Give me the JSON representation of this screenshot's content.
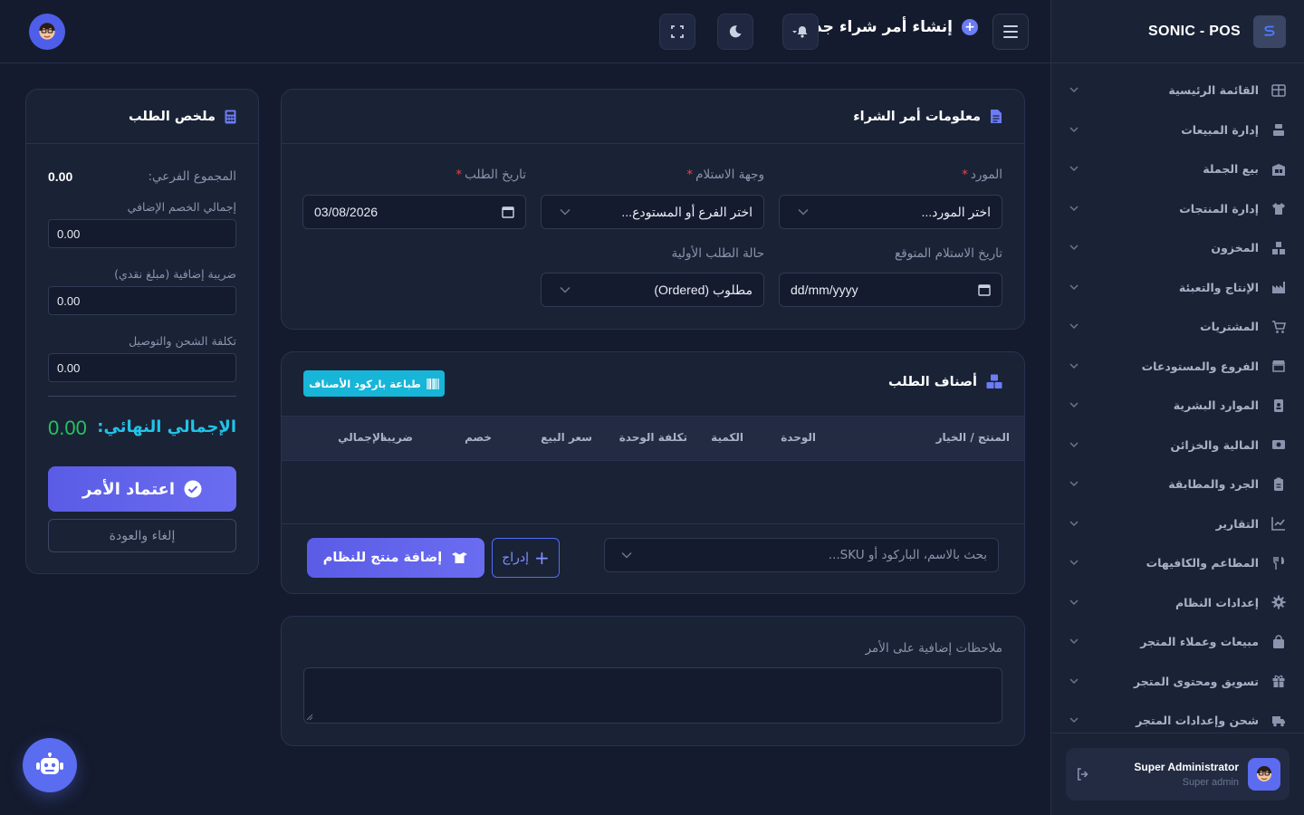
{
  "brand": {
    "name": "SONIC - POS"
  },
  "sidebar": {
    "items": [
      {
        "label": "القائمة الرئيسية",
        "icon": "table-icon"
      },
      {
        "label": "إدارة المبيعات",
        "icon": "register-icon"
      },
      {
        "label": "بيع الجملة",
        "icon": "warehouse-boxes-icon"
      },
      {
        "label": "إدارة المنتجات",
        "icon": "shirt-icon"
      },
      {
        "label": "المخزون",
        "icon": "boxes-icon"
      },
      {
        "label": "الإنتاج والتعبئة",
        "icon": "industry-icon"
      },
      {
        "label": "المشتريات",
        "icon": "cart-icon"
      },
      {
        "label": "الفروع والمستودعات",
        "icon": "store-icon"
      },
      {
        "label": "الموارد البشرية",
        "icon": "id-badge-icon"
      },
      {
        "label": "المالية والخزائن",
        "icon": "money-icon"
      },
      {
        "label": "الجرد والمطابقة",
        "icon": "clipboard-icon"
      },
      {
        "label": "التقارير",
        "icon": "chart-line-icon"
      },
      {
        "label": "المطاعم والكافيهات",
        "icon": "utensils-icon"
      },
      {
        "label": "إعدادات النظام",
        "icon": "gear-icon"
      },
      {
        "label": "مبيعات وعملاء المتجر",
        "icon": "bag-icon"
      },
      {
        "label": "تسويق ومحتوى المتجر",
        "icon": "gift-icon"
      },
      {
        "label": "شحن وإعدادات المتجر",
        "icon": "truck-icon"
      }
    ],
    "user": {
      "name": "Super Administrator",
      "role": "Super admin"
    }
  },
  "header": {
    "title": "إنشاء أمر شراء جديد"
  },
  "order_info": {
    "title": "معلومات أمر الشراء",
    "supplier": {
      "label": "المورد",
      "placeholder": "اختر المورد..."
    },
    "destination": {
      "label": "وجهة الاستلام",
      "placeholder": "اختر الفرع أو المستودع..."
    },
    "order_date": {
      "label": "تاريخ الطلب",
      "value": "03/08/2026"
    },
    "expected_date": {
      "label": "تاريخ الاستلام المتوقع",
      "value": "dd/mm/yyyy"
    },
    "initial_status": {
      "label": "حالة الطلب الأولية",
      "value": "مطلوب (Ordered)"
    }
  },
  "items": {
    "title": "أصناف الطلب",
    "print_barcode": "طباعة باركود الأصناف",
    "columns": [
      "المنتج / الخيار",
      "الوحدة",
      "الكمية",
      "تكلفة الوحدة",
      "سعر البيع",
      "خصم",
      "ضريبة",
      "الإجمالي"
    ],
    "search_placeholder": "بحث بالاسم، الباركود أو SKU...",
    "insert_label": "إدراج",
    "add_product_label": "إضافة منتج للنظام"
  },
  "notes": {
    "label": "ملاحظات إضافية على الأمر"
  },
  "summary": {
    "title": "ملخص الطلب",
    "subtotal_label": "المجموع الفرعي:",
    "subtotal": "0.00",
    "discount_label": "إجمالي الخصم الإضافي",
    "discount": "0.00",
    "tax_label": "ضريبة إضافية (مبلغ نقدي)",
    "tax": "0.00",
    "shipping_label": "تكلفة الشحن والتوصيل",
    "shipping": "0.00",
    "total_label": "الإجمالي النهائي:",
    "total": "0.00",
    "approve_label": "اعتماد الأمر",
    "cancel_label": "إلغاء والعودة"
  },
  "colors": {
    "accent": "#5b5ce6",
    "cyan": "#17b5d8",
    "total_green": "#22c55e",
    "total_label": "#22c3e6"
  }
}
